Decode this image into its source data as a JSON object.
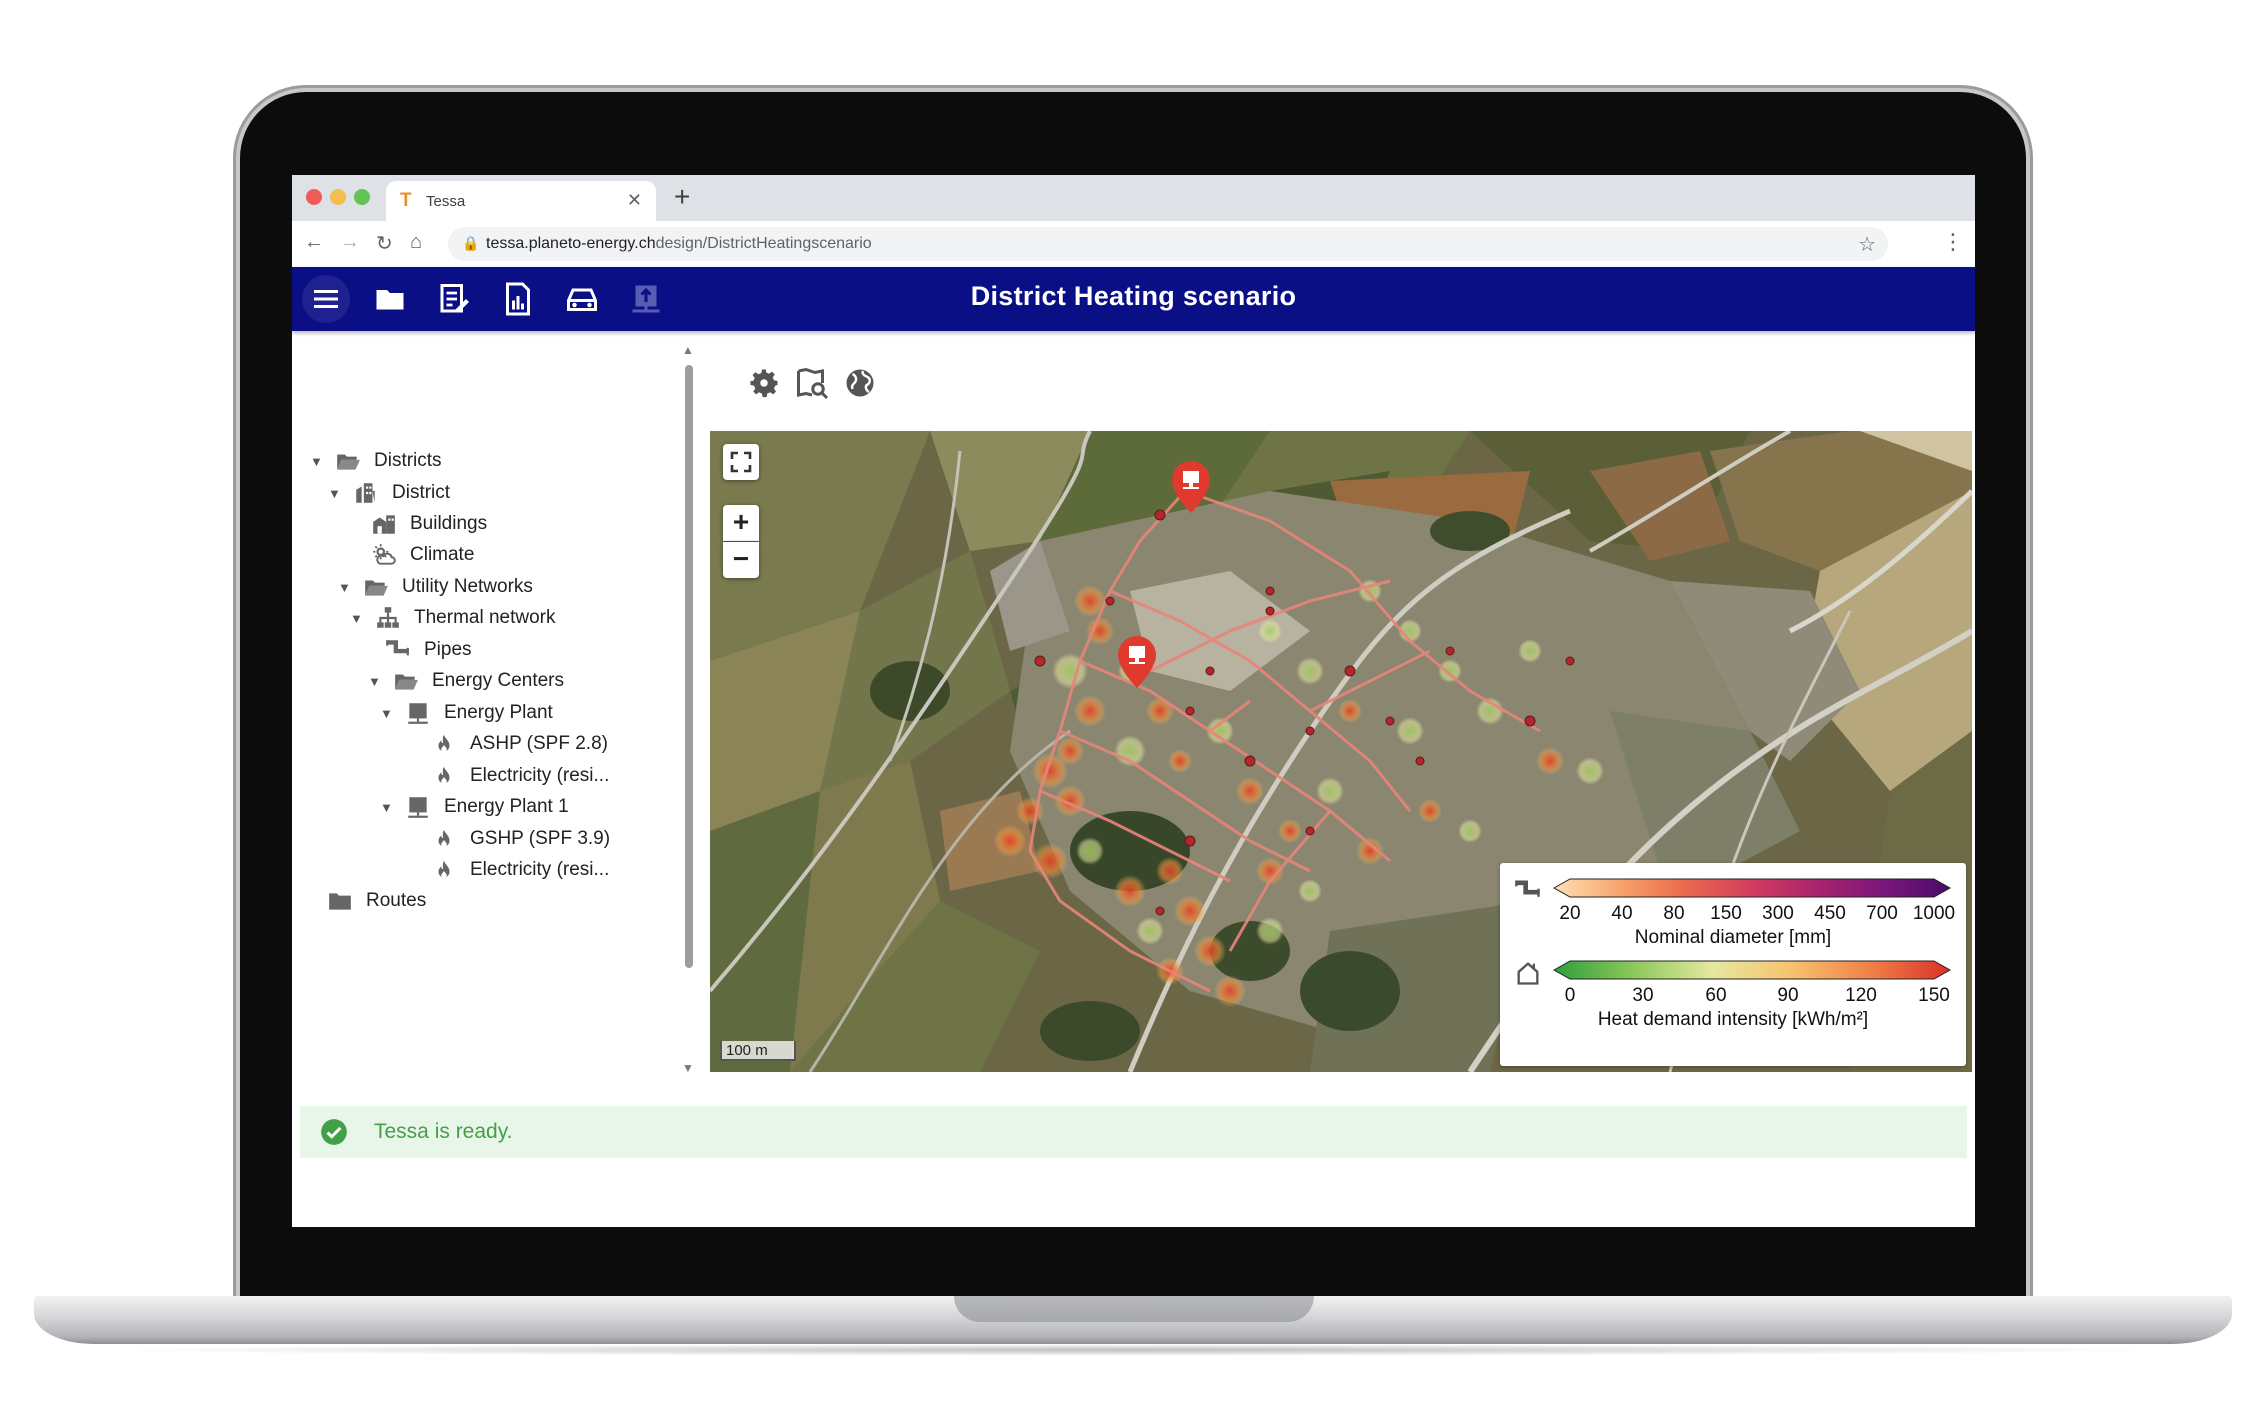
{
  "browser": {
    "tab_title": "Tessa",
    "tab_favicon": "T",
    "url_host": "tessa.planeto-energy.ch",
    "url_path": "design/DistrictHeatingscenario"
  },
  "app": {
    "title": "District Heating scenario",
    "toolbar_icons": [
      "menu-icon",
      "folder-icon",
      "edit-note-icon",
      "report-icon",
      "vehicle-icon",
      "upload-icon"
    ]
  },
  "tree": {
    "items": [
      {
        "label": "Districts",
        "icon": "folder-open-icon",
        "expanded": true
      },
      {
        "label": "District",
        "icon": "building-icon",
        "expanded": true
      },
      {
        "label": "Buildings",
        "icon": "buildings-icon"
      },
      {
        "label": "Climate",
        "icon": "climate-icon"
      },
      {
        "label": "Utility Networks",
        "icon": "folder-open-icon",
        "expanded": true
      },
      {
        "label": "Thermal network",
        "icon": "network-icon",
        "expanded": true
      },
      {
        "label": "Pipes",
        "icon": "pipe-icon"
      },
      {
        "label": "Energy Centers",
        "icon": "folder-open-icon",
        "expanded": true
      },
      {
        "label": "Energy Plant",
        "icon": "plant-icon",
        "expanded": true
      },
      {
        "label": "ASHP (SPF 2.8)",
        "icon": "flame-icon"
      },
      {
        "label": "Electricity (resi...",
        "icon": "flame-icon"
      },
      {
        "label": "Energy Plant 1",
        "icon": "plant-icon",
        "expanded": true
      },
      {
        "label": "GSHP (SPF 3.9)",
        "icon": "flame-icon"
      },
      {
        "label": "Electricity (resi...",
        "icon": "flame-icon"
      },
      {
        "label": "Routes",
        "icon": "folder-icon"
      }
    ]
  },
  "map": {
    "zoom_in": "+",
    "zoom_out": "−",
    "scale_label": "100 m",
    "legend": {
      "diameter": {
        "ticks": [
          "20",
          "40",
          "80",
          "150",
          "300",
          "450",
          "700",
          "1000"
        ],
        "title": "Nominal diameter [mm]",
        "colors": [
          "#fde0b5",
          "#f7a26a",
          "#ea6a4d",
          "#d23c5e",
          "#a8236e",
          "#7b177a",
          "#4b0b6b"
        ]
      },
      "heat_demand": {
        "ticks": [
          "0",
          "30",
          "60",
          "90",
          "120",
          "150"
        ],
        "title": "Heat demand intensity [kWh/m²]",
        "colors": [
          "#2e9e3c",
          "#8cc85a",
          "#e5e8a0",
          "#f7c26e",
          "#f08049",
          "#d93126"
        ]
      }
    }
  },
  "status": {
    "message": "Tessa is ready."
  }
}
